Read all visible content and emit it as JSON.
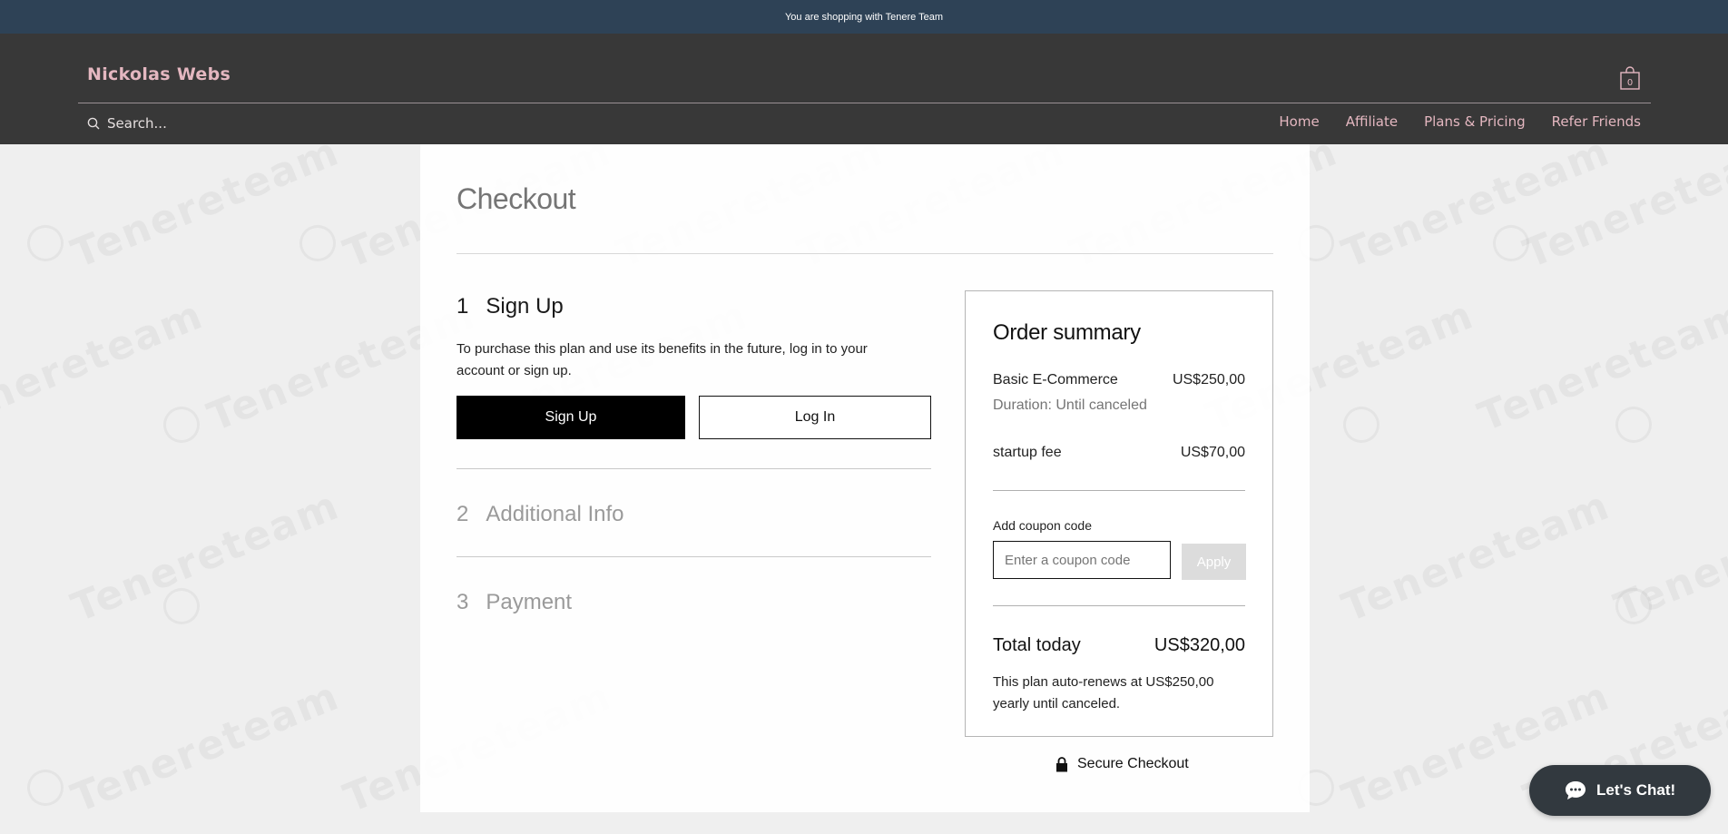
{
  "topbar": {
    "text": "You are shopping with Tenere Team"
  },
  "header": {
    "brand": "Nickolas Webs",
    "cart_count": "0",
    "search_placeholder": "Search...",
    "nav": [
      "Home",
      "Affiliate",
      "Plans & Pricing",
      "Refer Friends"
    ]
  },
  "watermark": {
    "text": "Tenereteam"
  },
  "checkout": {
    "title": "Checkout",
    "steps": [
      {
        "number": "1",
        "label": "Sign Up"
      },
      {
        "number": "2",
        "label": "Additional Info"
      },
      {
        "number": "3",
        "label": "Payment"
      }
    ],
    "signup_description": "To purchase this plan and use its benefits in the future, log in to your account or sign up.",
    "signup_button": "Sign Up",
    "login_button": "Log In"
  },
  "summary": {
    "title": "Order summary",
    "plan_name": "Basic E-Commerce",
    "plan_price": "US$250,00",
    "duration": "Duration: Until canceled",
    "fee_name": "startup fee",
    "fee_price": "US$70,00",
    "coupon_label": "Add coupon code",
    "coupon_placeholder": "Enter a coupon code",
    "apply_button": "Apply",
    "total_label": "Total today",
    "total_value": "US$320,00",
    "renew_note": "This plan auto-renews at US$250,00 yearly until canceled."
  },
  "secure_checkout": "Secure Checkout",
  "chat": {
    "label": "Let's Chat!"
  },
  "colors": {
    "topbar": "#2e4256",
    "header": "#383838",
    "brand_accent": "#e4b7c0",
    "background": "#efefef",
    "chat": "#32393f"
  }
}
